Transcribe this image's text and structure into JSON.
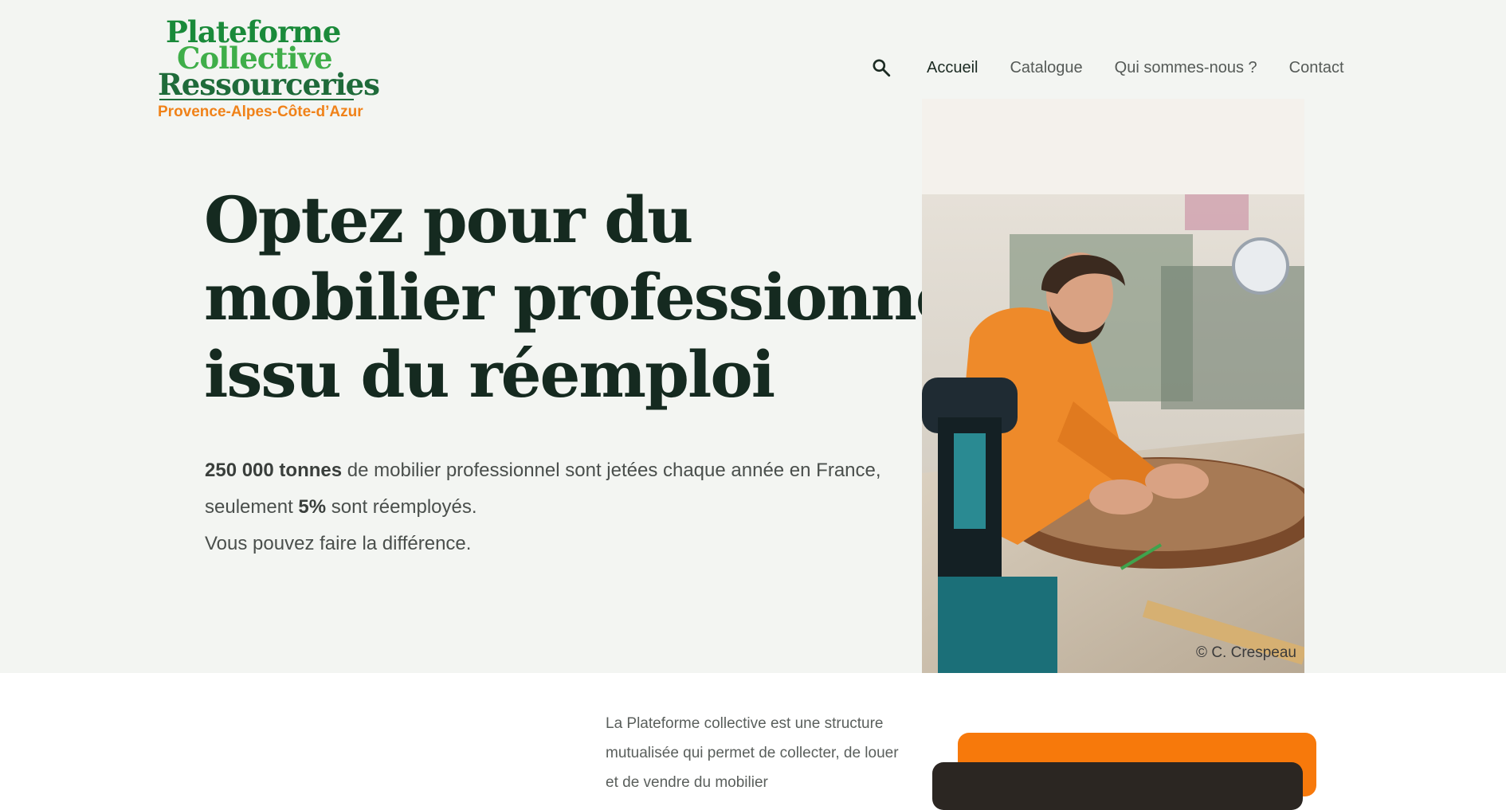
{
  "logo": {
    "line1": "Plateforme",
    "line2": "Collective",
    "line3": "Ressourceries",
    "region": "Provence-Alpes-Côte-d’Azur"
  },
  "nav": {
    "items": [
      {
        "label": "Accueil",
        "active": true
      },
      {
        "label": "Catalogue",
        "active": false
      },
      {
        "label": "Qui sommes-nous ?",
        "active": false
      },
      {
        "label": "Contact",
        "active": false
      }
    ]
  },
  "hero": {
    "headline": [
      "Optez pour du",
      "mobilier professionnel",
      "issu du réemploi"
    ],
    "stat_tonnes": "250 000 tonnes",
    "stat_text": "de mobilier professionnel sont jetées chaque année en France,",
    "stat2_prefix": "seulement",
    "stat_percent": "5%",
    "stat2_suffix": "sont réemployés.",
    "cta_line": "Vous pouvez faire la différence.",
    "photo_credit": "© C. Crespeau"
  },
  "about": {
    "text": "La Plateforme collective est une structure mutualisée qui permet de collecter, de louer et de vendre du mobilier"
  },
  "colors": {
    "brand_green": "#1a8a3a",
    "brand_orange": "#f08219",
    "hero_bg": "#f3f5f2"
  }
}
